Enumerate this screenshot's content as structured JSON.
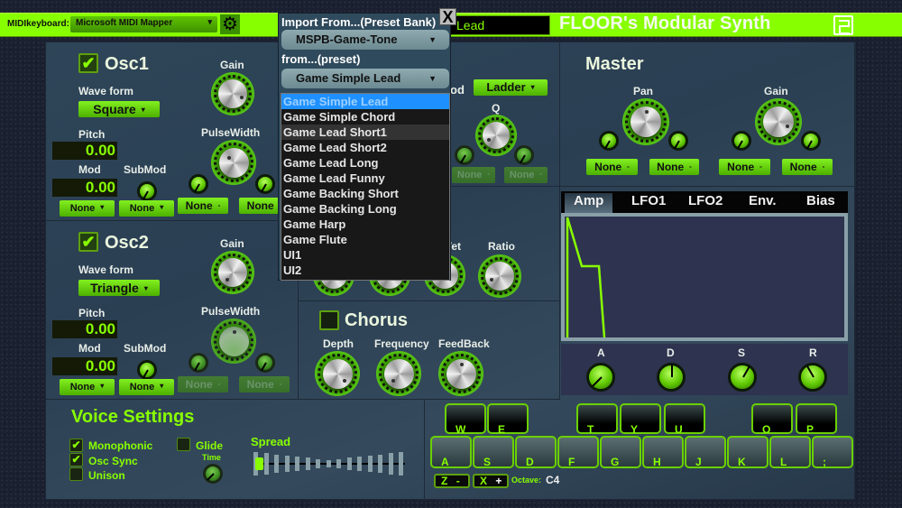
{
  "topbar": {
    "midi_label": "MIDIkeyboard:",
    "midi_device": "Microsoft MIDI Mapper",
    "settings_icon": "gear-icon",
    "preset_name": "Lead",
    "app_title": "FLOOR's Modular Synth",
    "logo_icon": "floor-logo-icon",
    "accent_color": "#88ff00"
  },
  "import_dialog": {
    "bank_label": "Import From...(Preset Bank)",
    "bank_selected": "MSPB-Game-Tone",
    "preset_label": "from...(preset)",
    "preset_selected": "Game Simple Lead",
    "close_label": "X",
    "options": [
      "Game Simple Lead",
      "Game Simple Chord",
      "Game Lead Short1",
      "Game Lead Short2",
      "Game Lead Long",
      "Game Lead Funny",
      "Game Backing Short",
      "Game Backing Long",
      "Game Harp",
      "Game Flute",
      "UI1",
      "UI2"
    ],
    "selected_index": 0,
    "hover_index": 2
  },
  "osc1": {
    "title": "Osc1",
    "enabled": true,
    "waveform_label": "Wave form",
    "waveform": "Square",
    "gain_label": "Gain",
    "pulsewidth_label": "PulseWidth",
    "pitch_label": "Pitch",
    "pitch": "0.00",
    "mod_label": "Mod",
    "mod": "0.00",
    "submod_label": "SubMod",
    "mod_sources": [
      "None",
      "None",
      "None",
      "None"
    ]
  },
  "osc2": {
    "title": "Osc2",
    "enabled": true,
    "waveform_label": "Wave form",
    "waveform": "Triangle",
    "gain_label": "Gain",
    "pulsewidth_label": "PulseWidth",
    "pitch_label": "Pitch",
    "pitch": "0.00",
    "mod_label": "Mod",
    "mod": "0.00",
    "submod_label": "SubMod",
    "mod_sources": [
      "None",
      "None",
      "None",
      "None"
    ]
  },
  "filter": {
    "method_label_partial": "od",
    "method": "Ladder",
    "q_label": "Q",
    "mod_sources": [
      "None",
      "None"
    ]
  },
  "effects": {
    "wet_label_partial": "Vet",
    "ratio_label": "Ratio",
    "chorus_title": "Chorus",
    "chorus_enabled": false,
    "depth_label": "Depth",
    "frequency_label": "Frequency",
    "feedback_label": "FeedBack"
  },
  "master": {
    "title": "Master",
    "pan_label": "Pan",
    "gain_label": "Gain",
    "mod_sources": [
      "None",
      "None",
      "None",
      "None"
    ]
  },
  "envelope": {
    "tabs": [
      "Amp",
      "LFO1",
      "LFO2",
      "Env.",
      "Bias"
    ],
    "active_tab": "Amp",
    "knob_labels": [
      "A",
      "D",
      "S",
      "R"
    ]
  },
  "voice": {
    "title": "Voice Settings",
    "monophonic_label": "Monophonic",
    "monophonic": true,
    "osc_sync_label": "Osc Sync",
    "osc_sync": true,
    "unison_label": "Unison",
    "unison": false,
    "glide_label": "Glide",
    "glide": false,
    "time_label": "Time",
    "spread_label": "Spread",
    "spread_value": 0
  },
  "keyboard": {
    "black_keys": [
      "W",
      "E",
      "T",
      "Y",
      "U",
      "O",
      "P"
    ],
    "white_keys": [
      "A",
      "S",
      "D",
      "F",
      "G",
      "H",
      "J",
      "K",
      "L",
      ";"
    ],
    "octave_down": "Z",
    "octave_down_sign": "-",
    "octave_up": "X",
    "octave_up_sign": "+",
    "octave_label": "Octave:",
    "octave_value": "C4"
  }
}
